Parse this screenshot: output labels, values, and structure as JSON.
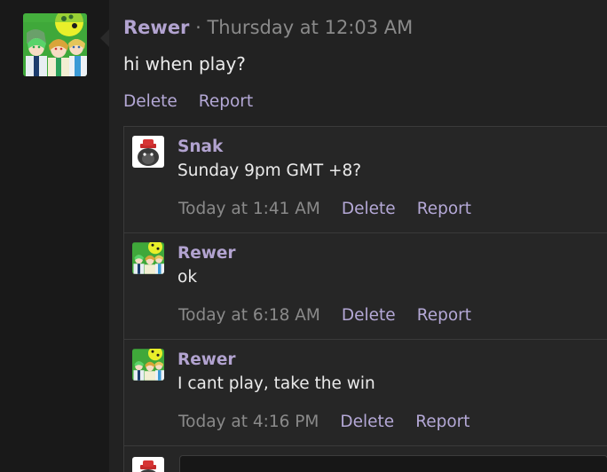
{
  "post": {
    "username": "Rewer",
    "separator": "·",
    "timestamp": "Thursday at 12:03 AM",
    "message": "hi when play?",
    "actions": {
      "delete": "Delete",
      "report": "Report"
    },
    "avatar_icon": "anime-group-avatar"
  },
  "replies": [
    {
      "username": "Snak",
      "message": "Sunday 9pm GMT +8?",
      "time": "Today at 1:41 AM",
      "delete": "Delete",
      "report": "Report",
      "avatar_icon": "penguin-red-hat-avatar"
    },
    {
      "username": "Rewer",
      "message": "ok",
      "time": "Today at 6:18 AM",
      "delete": "Delete",
      "report": "Report",
      "avatar_icon": "anime-group-avatar"
    },
    {
      "username": "Rewer",
      "message": "I cant play, take the win",
      "time": "Today at 4:16 PM",
      "delete": "Delete",
      "report": "Report",
      "avatar_icon": "anime-group-avatar"
    }
  ],
  "composer": {
    "placeholder": "",
    "avatar_icon": "penguin-red-hat-avatar"
  },
  "colors": {
    "username": "#b2a3d0",
    "link": "#b4a8d6",
    "meta": "#8a8a8a",
    "background": "#1f1f1f"
  }
}
